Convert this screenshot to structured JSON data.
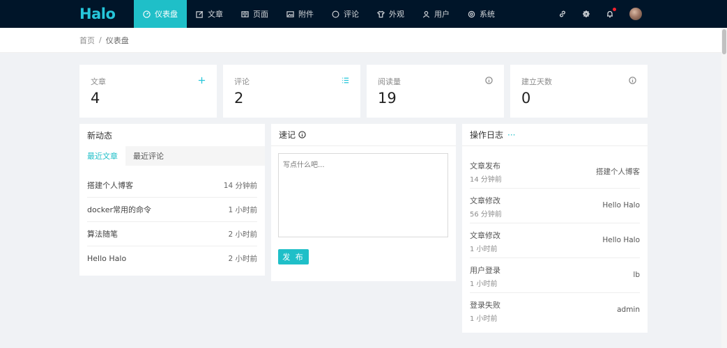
{
  "app": {
    "logo_text": "Halo",
    "accent_color": "#1fbfc8",
    "topbar_color": "#001529"
  },
  "nav": [
    {
      "label": "仪表盘",
      "icon": "dashboard-icon",
      "active": true
    },
    {
      "label": "文章",
      "icon": "edit-icon"
    },
    {
      "label": "页面",
      "icon": "read-icon"
    },
    {
      "label": "附件",
      "icon": "picture-icon"
    },
    {
      "label": "评论",
      "icon": "message-icon"
    },
    {
      "label": "外观",
      "icon": "skin-icon"
    },
    {
      "label": "用户",
      "icon": "user-icon"
    },
    {
      "label": "系统",
      "icon": "setting-icon"
    }
  ],
  "breadcrumb": {
    "home": "首页",
    "separator": "/",
    "current": "仪表盘"
  },
  "stats": [
    {
      "label": "文章",
      "value": "4",
      "icon": "plus-icon"
    },
    {
      "label": "评论",
      "value": "2",
      "icon": "list-icon"
    },
    {
      "label": "阅读量",
      "value": "19",
      "icon": "info-circle-icon"
    },
    {
      "label": "建立天数",
      "value": "0",
      "icon": "info-circle-icon"
    }
  ],
  "activity": {
    "title": "新动态",
    "tabs": [
      "最近文章",
      "最近评论"
    ],
    "posts": [
      {
        "title": "搭建个人博客",
        "time": "14 分钟前"
      },
      {
        "title": "docker常用的命令",
        "time": "1 小时前"
      },
      {
        "title": "算法随笔",
        "time": "2 小时前"
      },
      {
        "title": "Hello Halo",
        "time": "2 小时前"
      }
    ]
  },
  "memo": {
    "title": "速记",
    "placeholder": "写点什么吧...",
    "publish_label": "发 布"
  },
  "logs": {
    "title": "操作日志",
    "more": "···",
    "items": [
      {
        "type": "文章发布",
        "time": "14 分钟前",
        "content": "搭建个人博客"
      },
      {
        "type": "文章修改",
        "time": "56 分钟前",
        "content": "Hello Halo"
      },
      {
        "type": "文章修改",
        "time": "1 小时前",
        "content": "Hello Halo"
      },
      {
        "type": "用户登录",
        "time": "1 小时前",
        "content": "lb"
      },
      {
        "type": "登录失败",
        "time": "1 小时前",
        "content": "admin"
      }
    ]
  }
}
